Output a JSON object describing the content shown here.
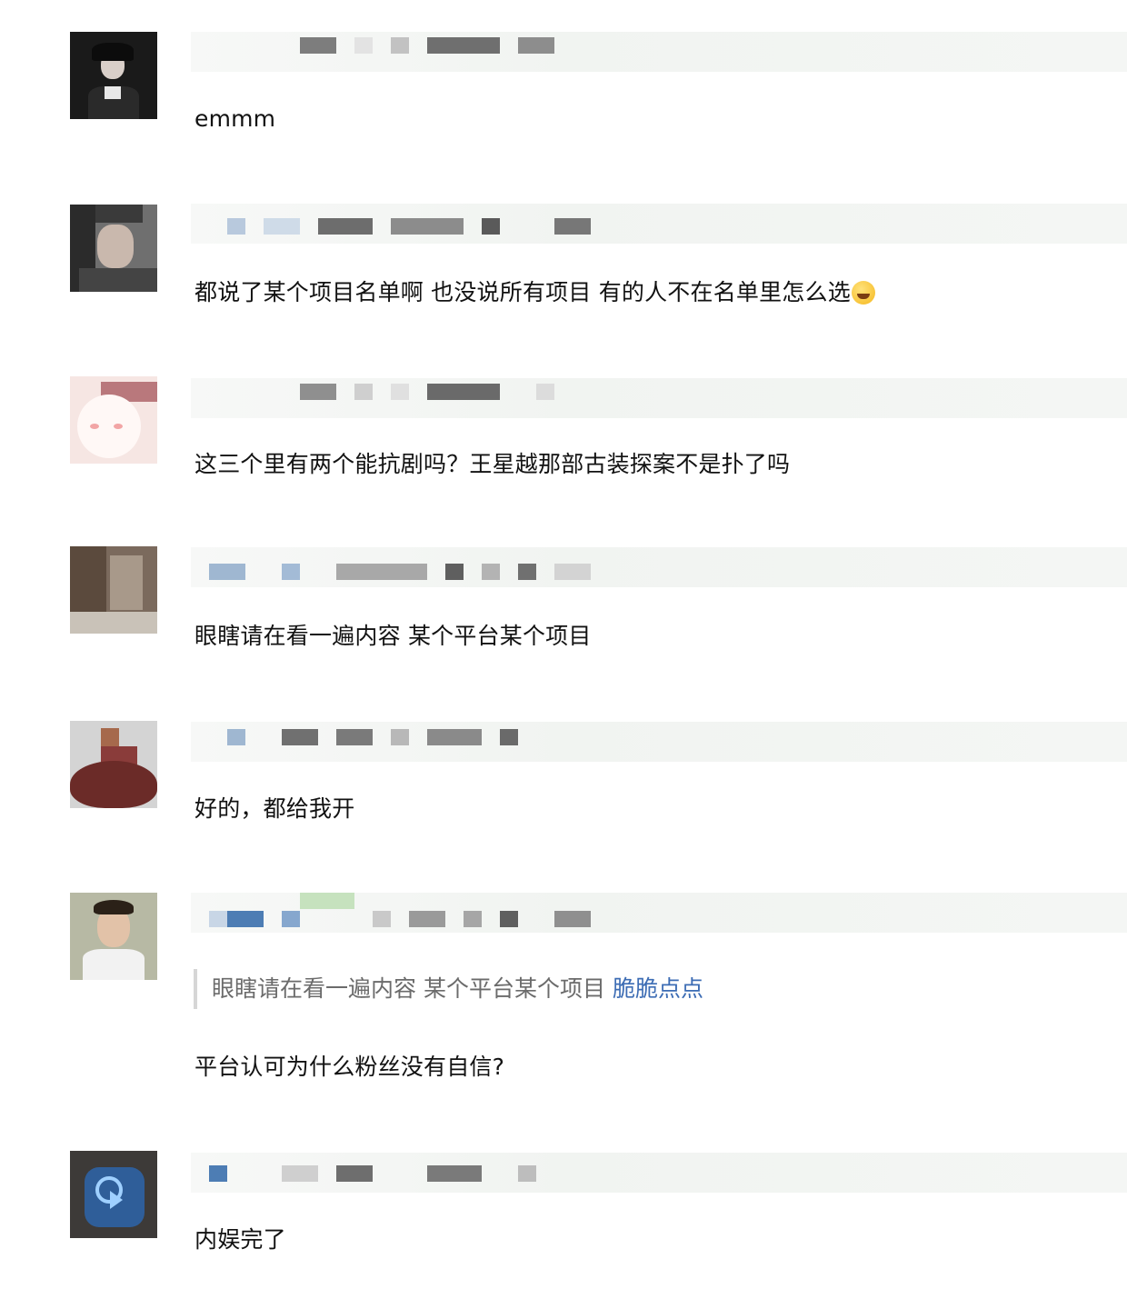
{
  "comments": [
    {
      "text": "emmm",
      "avatar_icon": "girl-portrait-avatar"
    },
    {
      "text": "都说了某个项目名单啊 也没说所有项目 有的人不在名单里怎么选",
      "emoji": "laughing-tears-emoji",
      "avatar_icon": "dark-portrait-avatar"
    },
    {
      "text": "这三个里有两个能抗剧吗？王星越那部古装探案不是扑了吗",
      "avatar_icon": "cartoon-pink-avatar"
    },
    {
      "text": "眼瞎请在看一遍内容 某个平台某个项目",
      "avatar_icon": "room-photo-avatar"
    },
    {
      "text": "好的，都给我开",
      "avatar_icon": "red-leaf-avatar"
    },
    {
      "quote": {
        "text": "眼瞎请在看一遍内容 某个平台某个项目",
        "link": "脆脆点点"
      },
      "text": "平台认可为什么粉丝没有自信?",
      "avatar_icon": "woman-portrait-avatar"
    },
    {
      "text": "内娱完了",
      "avatar_icon": "blue-cursor-app-avatar"
    }
  ]
}
